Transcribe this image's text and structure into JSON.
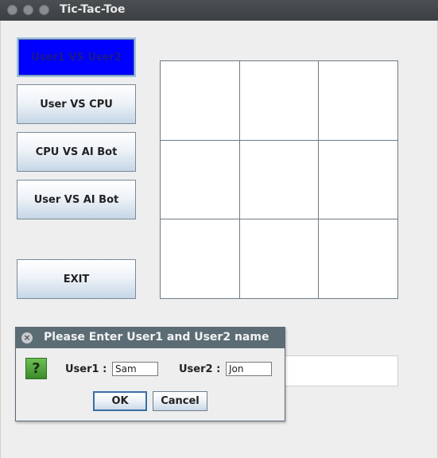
{
  "window": {
    "title": "Tic-Tac-Toe"
  },
  "modes": {
    "user_vs_user": "User1 VS User2",
    "user_vs_cpu": "User VS CPU",
    "cpu_vs_ai": "CPU VS AI Bot",
    "user_vs_ai": "User VS AI Bot",
    "exit": "EXIT"
  },
  "board": {
    "cells": [
      "",
      "",
      "",
      "",
      "",
      "",
      "",
      "",
      ""
    ]
  },
  "dialog": {
    "title": "Please Enter User1 and User2 name",
    "user1_label": "User1 :",
    "user1_value": "Sam",
    "user2_label": "User2 :",
    "user2_value": "Jon",
    "ok_label": "OK",
    "cancel_label": "Cancel"
  },
  "colors": {
    "active_button": "#0000ff",
    "titlebar": "#3c4043",
    "dialog_titlebar": "#5b6c75"
  }
}
